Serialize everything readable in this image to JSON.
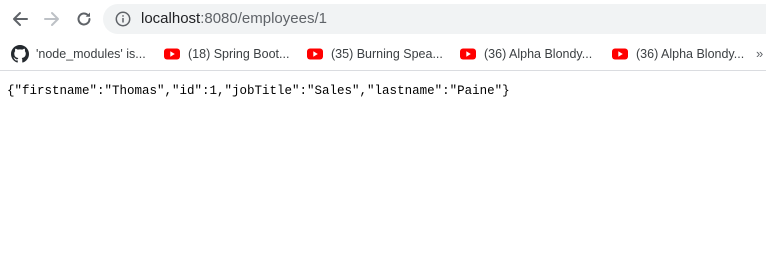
{
  "browser": {
    "address_bar": {
      "host": "localhost",
      "path": ":8080/employees/1"
    },
    "bookmarks": [
      {
        "label": "'node_modules' is...",
        "icon": "github-icon"
      },
      {
        "label": "(18) Spring Boot...",
        "icon": "youtube-icon"
      },
      {
        "label": "(35) Burning Spea...",
        "icon": "youtube-icon"
      },
      {
        "label": "(36) Alpha Blondy...",
        "icon": "youtube-icon"
      },
      {
        "label": "(36) Alpha Blondy...",
        "icon": "youtube-icon"
      }
    ],
    "colors": {
      "youtube_red": "#ff0000",
      "omnibox_bg": "#f1f3f4"
    }
  },
  "page": {
    "body_text": "{\"firstname\":\"Thomas\",\"id\":1,\"jobTitle\":\"Sales\",\"lastname\":\"Paine\"}"
  }
}
